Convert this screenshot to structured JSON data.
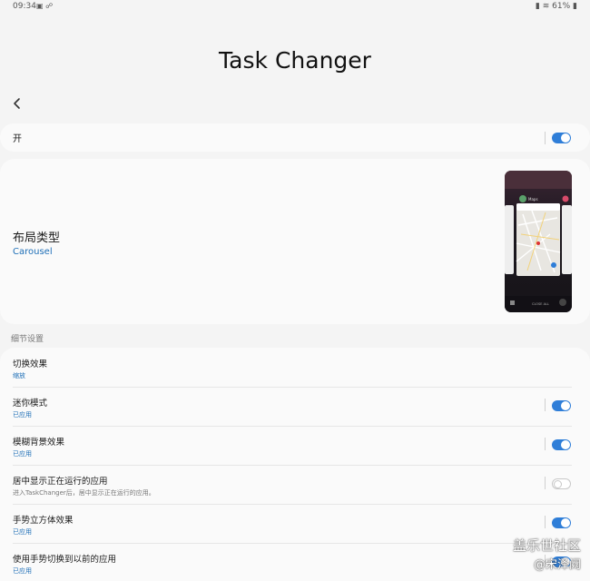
{
  "status_bar": {
    "time": "09:34",
    "left_icons": "▣ ☍",
    "right": "61%"
  },
  "page": {
    "title": "Task Changer"
  },
  "main_toggle": {
    "label": "开",
    "on": true
  },
  "layout": {
    "title": "布局类型",
    "value": "Carousel"
  },
  "detail_section": {
    "header": "细节设置"
  },
  "details": [
    {
      "title": "切换效果",
      "subtitle": "缩放"
    },
    {
      "title": "迷你模式",
      "subtitle": "已应用",
      "on": true
    },
    {
      "title": "模糊背景效果",
      "subtitle": "已应用",
      "on": true
    },
    {
      "title": "居中显示正在运行的应用",
      "subtitle": "进入TaskChanger后，居中显示正在运行的应用。",
      "on": false
    },
    {
      "title": "手势立方体效果",
      "subtitle": "已应用",
      "on": true
    },
    {
      "title": "使用手势切换到以前的应用",
      "subtitle": "已应用",
      "on": true
    }
  ],
  "watermark": {
    "line1": "盖乐世社区",
    "line2": "@宋泽阙"
  },
  "colors": {
    "accent": "#2f7ed8",
    "link": "#1e6fb7",
    "background": "#f4f4f4",
    "card": "#fafafa"
  }
}
